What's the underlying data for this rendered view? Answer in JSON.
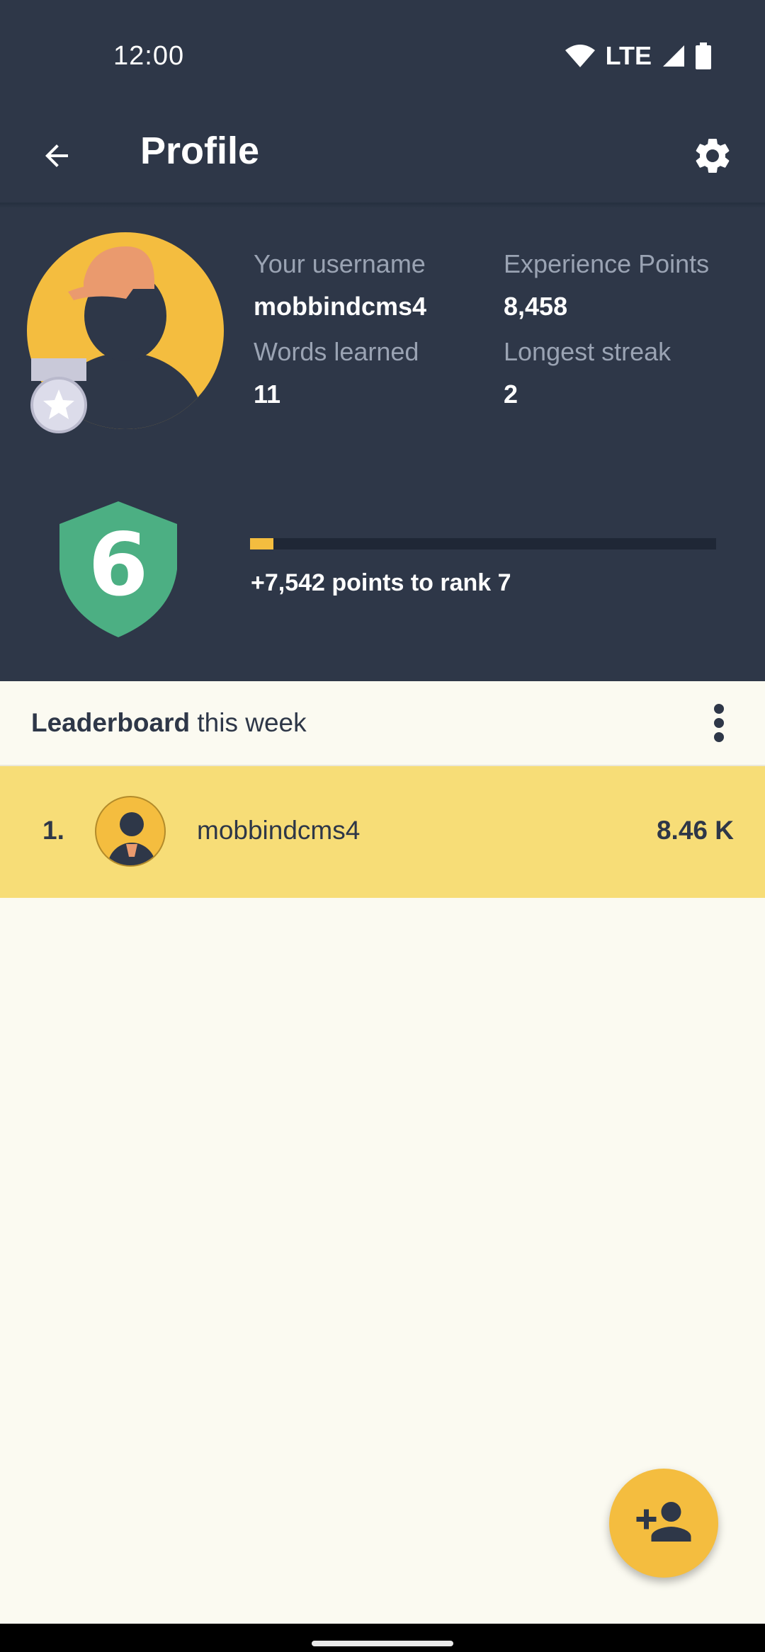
{
  "status_bar": {
    "time": "12:00",
    "network": "LTE",
    "icons": [
      "wifi-icon",
      "cell-signal-icon",
      "battery-icon"
    ]
  },
  "app_bar": {
    "title": "Profile",
    "back_icon": "arrow-back-icon",
    "settings_icon": "gear-icon"
  },
  "profile": {
    "stats": [
      {
        "label": "Your username",
        "value": "mobbindcms4"
      },
      {
        "label": "Experience Points",
        "value": "8,458"
      },
      {
        "label": "Words learned",
        "value": "11"
      },
      {
        "label": "Longest streak",
        "value": "2"
      }
    ],
    "rank": {
      "current": "6",
      "progress_fraction": 0.05,
      "progress_text": "+7,542 points to rank 7"
    }
  },
  "leaderboard": {
    "title_bold": "Leaderboard",
    "title_rest": " this week",
    "menu_icon": "more-vert-icon",
    "rows": [
      {
        "rank": "1.",
        "name": "mobbindcms4",
        "points": "8.46 K"
      }
    ]
  },
  "fab": {
    "icon": "add-person-icon"
  },
  "colors": {
    "header_bg": "#2e3748",
    "accent": "#f4bd3f",
    "rank_shield": "#4caf83",
    "highlight_row": "#f7dd77",
    "page_bg": "#fbfaf1"
  }
}
